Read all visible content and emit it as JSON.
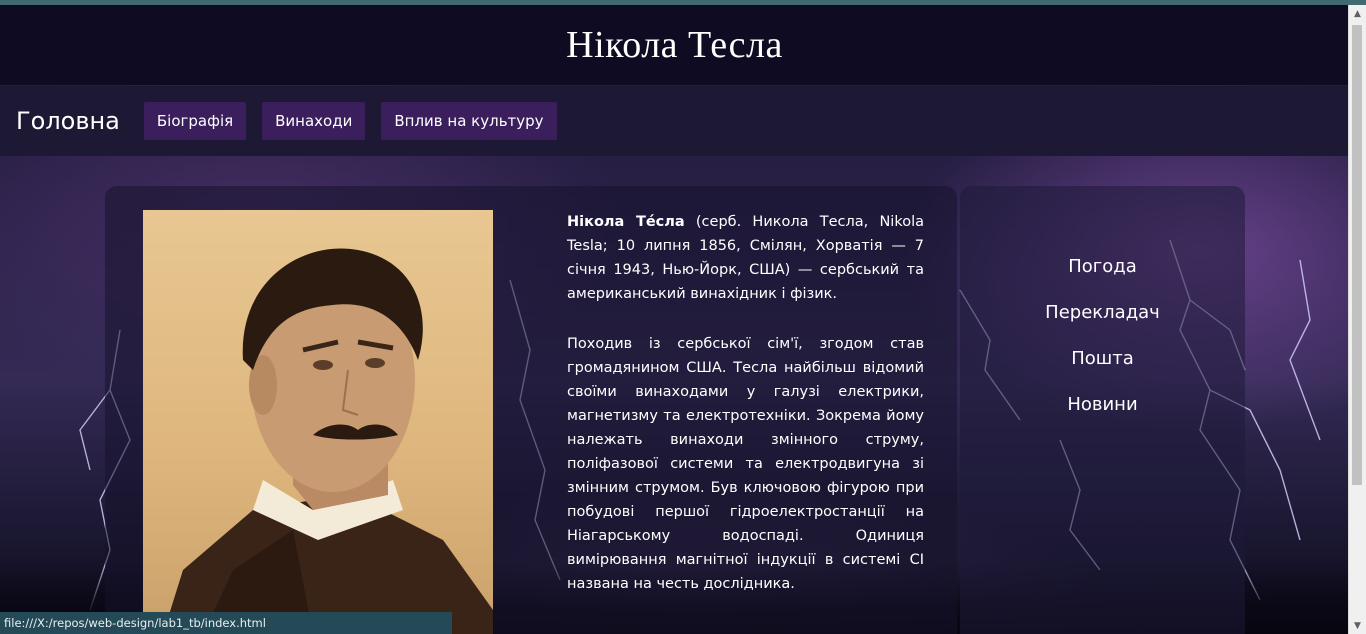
{
  "header": {
    "title": "Нікола Тесла"
  },
  "nav": {
    "brand": "Головна",
    "items": [
      {
        "label": "Біографія"
      },
      {
        "label": "Винаходи"
      },
      {
        "label": "Вплив на культуру"
      }
    ]
  },
  "article": {
    "intro_name": "Нікола Те́сла",
    "intro_rest": " (серб. Никола Тесла, Nikola Tesla; 10 липня 1856, Смілян, Хорватія — 7 січня 1943, Нью-Йорк, США) — сербський та американський винахідник і фізик.",
    "paragraph2": "Походив із сербської сім'ї, згодом став громадянином США. Тесла найбільш відомий своїми винаходами у галузі електрики, магнетизму та електротехніки. Зокрема йому належать винаходи змінного струму, поліфазової системи та електродвигуна зі змінним струмом. Був ключовою фігурою при побудові першої гідроелектростанції на Ніагарському водоспаді. Одиниця вимірювання магнітної індукції в системі СІ названа на честь дослідника."
  },
  "sidebar": {
    "links": [
      {
        "label": "Погода"
      },
      {
        "label": "Перекладач"
      },
      {
        "label": "Пошта"
      },
      {
        "label": "Новини"
      }
    ]
  },
  "status_bar": {
    "url": "file:///X:/repos/web-design/lab1_tb/index.html"
  },
  "colors": {
    "header_bg": "#0e0b22",
    "nav_bg": "#1d1833",
    "nav_button_bg": "#3b1f5c",
    "status_bar_bg": "#254a57"
  }
}
